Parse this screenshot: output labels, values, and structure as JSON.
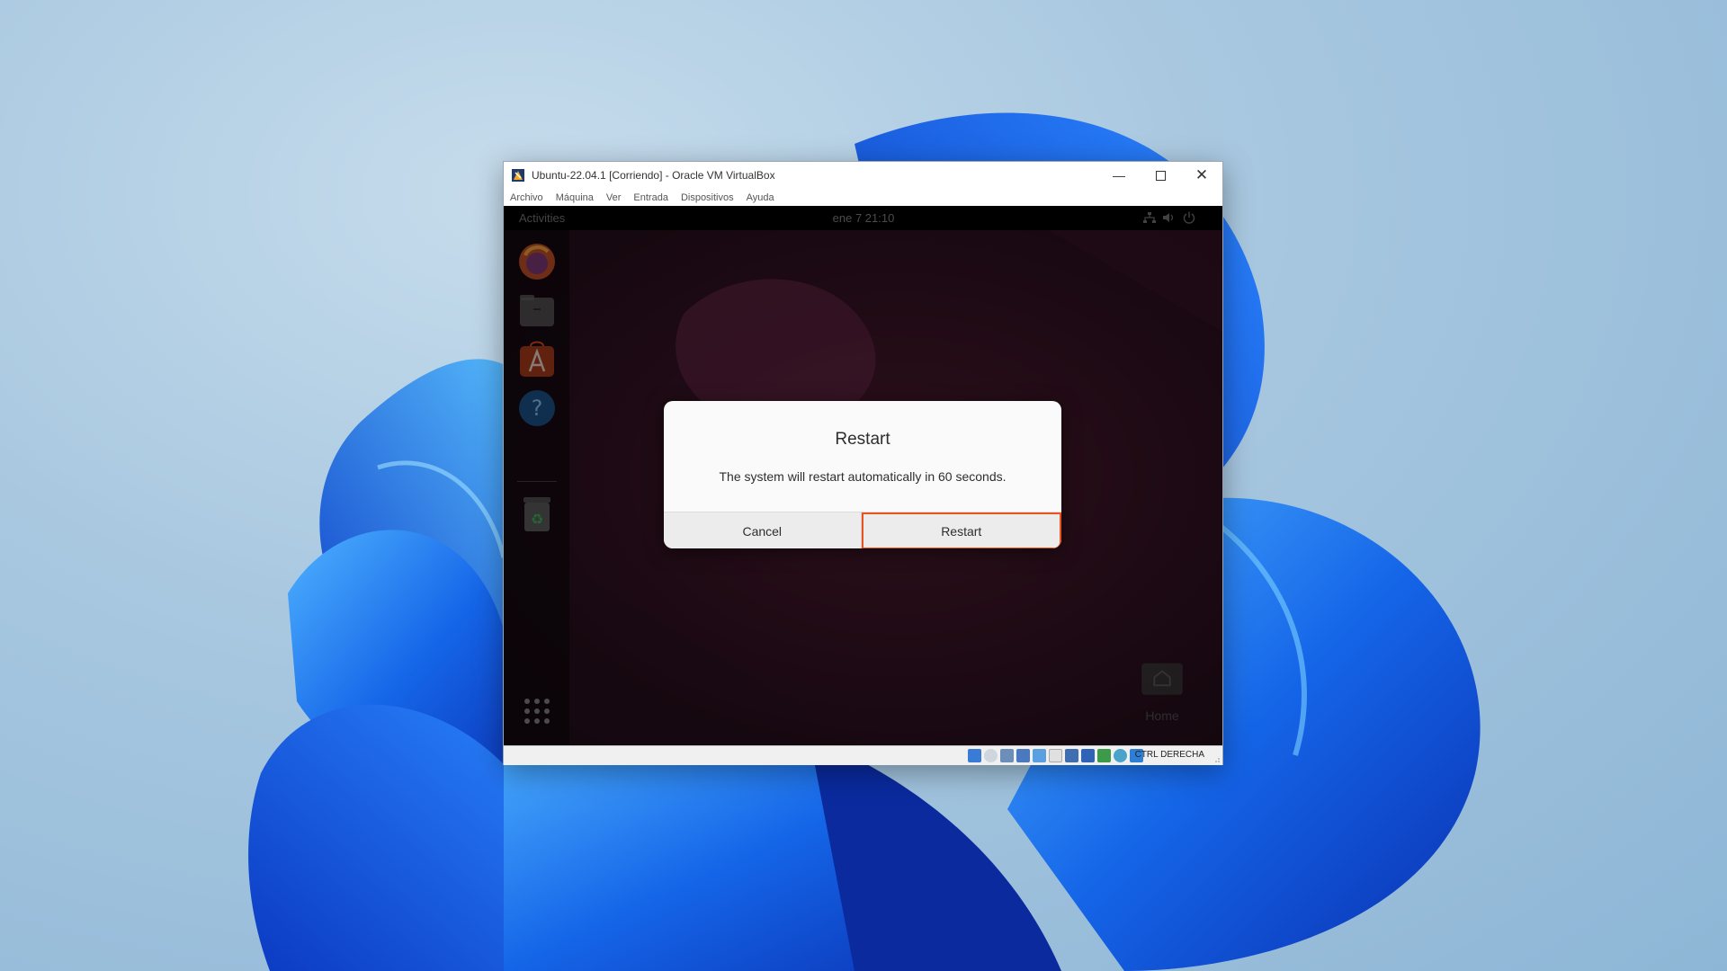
{
  "window": {
    "title": "Ubuntu-22.04.1 [Corriendo] - Oracle VM VirtualBox",
    "controls": [
      "minimize",
      "maximize",
      "close"
    ]
  },
  "menubar": {
    "items": [
      "Archivo",
      "Máquina",
      "Ver",
      "Entrada",
      "Dispositivos",
      "Ayuda"
    ]
  },
  "gnome": {
    "activities": "Activities",
    "clock": "ene 7  21:10",
    "tray_icons": [
      "network-icon",
      "volume-icon",
      "power-icon"
    ]
  },
  "dock": {
    "items": [
      "firefox-icon",
      "files-icon",
      "app-center-icon",
      "help-icon",
      "trash-icon",
      "show-apps-icon"
    ]
  },
  "desktop": {
    "home_label": "Home"
  },
  "dialog": {
    "title": "Restart",
    "message": "The system will restart automatically in 60 seconds.",
    "cancel_label": "Cancel",
    "restart_label": "Restart"
  },
  "statusbar": {
    "host_key": "CTRL DERECHA"
  },
  "colors": {
    "ubuntu_orange": "#e95420",
    "win_blue": "#1a5de0"
  }
}
